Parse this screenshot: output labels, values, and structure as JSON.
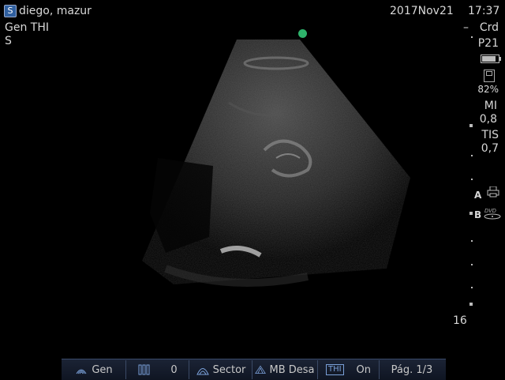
{
  "header": {
    "patient_name": "diego, mazur",
    "date": "2017Nov21",
    "time": "17:37",
    "preset": "Gen  THI",
    "sub_label": "S"
  },
  "side_panel": {
    "dash": "–",
    "probe_mode": "Crd",
    "probe_name": "P21",
    "disk_percent": "82%",
    "mi_label": "MI",
    "mi_value": "0,8",
    "tis_label": "TIS",
    "tis_value": "0,7",
    "marker_a": "A",
    "marker_b": "B",
    "depth": "16"
  },
  "icons": {
    "logo": "ultrasound-logo-icon",
    "battery": "battery-icon",
    "disk": "disk-icon",
    "printer": "printer-icon",
    "dvd": "dvd-icon",
    "orientation_marker_color": "#2eb36b"
  },
  "bottom_bar": {
    "gen_label": "Gen",
    "gain_value": "0",
    "sector_label": "Sector",
    "mb_label": "MB Desa",
    "thi_label": "On",
    "page_label": "Pág. 1/3"
  }
}
